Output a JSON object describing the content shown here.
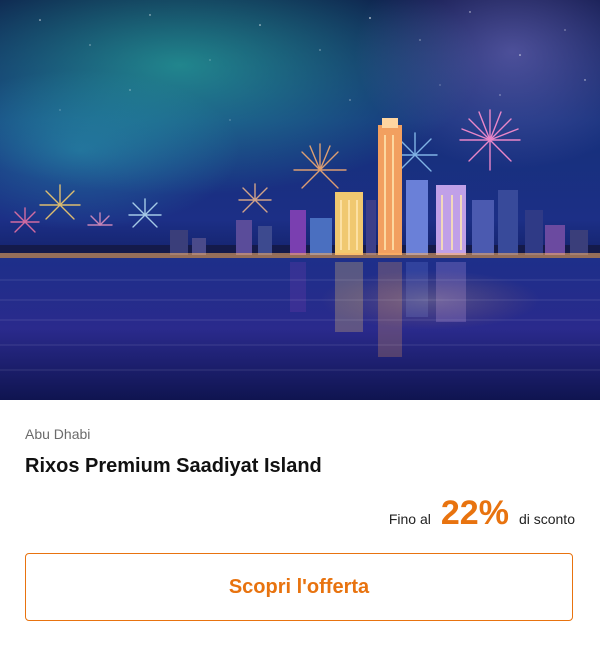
{
  "card": {
    "location": "Abu Dhabi",
    "hotel_name": "Rixos Premium Saadiyat Island",
    "discount": {
      "prefix": "Fino al",
      "value": "22%",
      "suffix": "di sconto"
    },
    "cta_label": "Scopri l'offerta"
  },
  "colors": {
    "accent": "#e8730f",
    "muted_text": "#6b6b6b"
  },
  "image_subject": "night-skyline-fireworks"
}
